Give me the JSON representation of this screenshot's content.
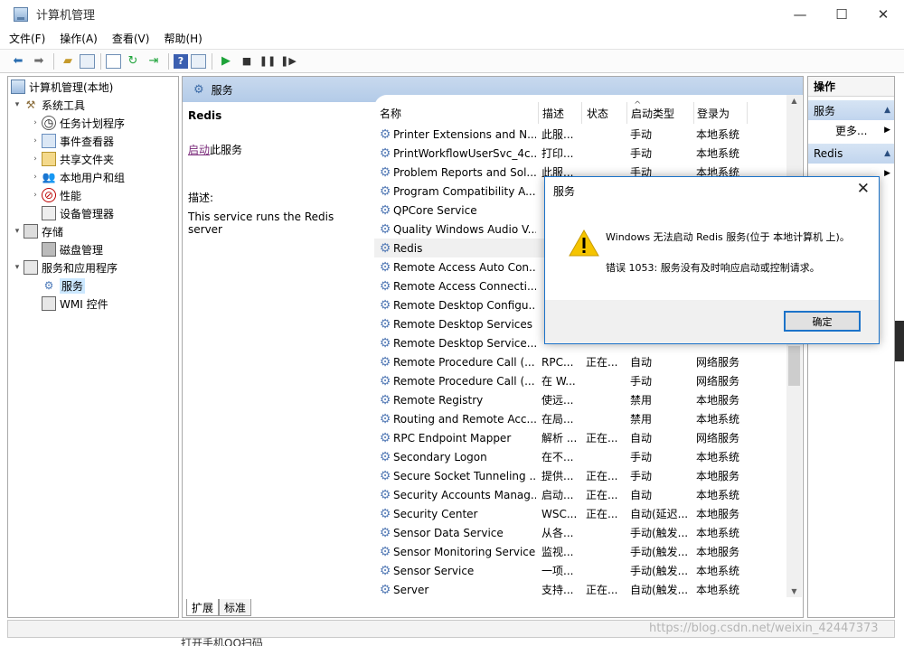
{
  "window": {
    "title": "计算机管理",
    "min": "—",
    "max": "☐",
    "close": "✕"
  },
  "menu": [
    "文件(F)",
    "操作(A)",
    "查看(V)",
    "帮助(H)"
  ],
  "tree": {
    "root": "计算机管理(本地)",
    "system_tools": "系统工具",
    "task_scheduler": "任务计划程序",
    "event_viewer": "事件查看器",
    "shared_folders": "共享文件夹",
    "local_users": "本地用户和组",
    "performance": "性能",
    "device_manager": "设备管理器",
    "storage": "存储",
    "disk_management": "磁盘管理",
    "services_apps": "服务和应用程序",
    "services": "服务",
    "wmi": "WMI 控件"
  },
  "middle": {
    "header": "服务",
    "selected_service": "Redis",
    "start_link": "启动",
    "start_suffix": "此服务",
    "desc_label": "描述:",
    "desc_text": "This service runs the Redis server"
  },
  "columns": {
    "name": "名称",
    "desc": "描述",
    "status": "状态",
    "start_type": "启动类型",
    "logon": "登录为"
  },
  "rows": [
    {
      "name": "Printer Extensions and N...",
      "desc": "此服...",
      "status": "",
      "start": "手动",
      "logon": "本地系统"
    },
    {
      "name": "PrintWorkflowUserSvc_4c...",
      "desc": "打印...",
      "status": "",
      "start": "手动",
      "logon": "本地系统"
    },
    {
      "name": "Problem Reports and Sol...",
      "desc": "此服...",
      "status": "",
      "start": "手动",
      "logon": "本地系统"
    },
    {
      "name": "Program Compatibility A...",
      "desc": "",
      "status": "",
      "start": "",
      "logon": ""
    },
    {
      "name": "QPCore Service",
      "desc": "",
      "status": "",
      "start": "",
      "logon": ""
    },
    {
      "name": "Quality Windows Audio V...",
      "desc": "",
      "status": "",
      "start": "",
      "logon": ""
    },
    {
      "name": "Redis",
      "desc": "",
      "status": "",
      "start": "",
      "logon": ""
    },
    {
      "name": "Remote Access Auto Con...",
      "desc": "",
      "status": "",
      "start": "",
      "logon": ""
    },
    {
      "name": "Remote Access Connecti...",
      "desc": "",
      "status": "",
      "start": "",
      "logon": ""
    },
    {
      "name": "Remote Desktop Configu...",
      "desc": "",
      "status": "",
      "start": "",
      "logon": ""
    },
    {
      "name": "Remote Desktop Services",
      "desc": "",
      "status": "",
      "start": "",
      "logon": ""
    },
    {
      "name": "Remote Desktop Service...",
      "desc": "",
      "status": "",
      "start": "",
      "logon": ""
    },
    {
      "name": "Remote Procedure Call (...",
      "desc": "RPC...",
      "status": "正在...",
      "start": "自动",
      "logon": "网络服务"
    },
    {
      "name": "Remote Procedure Call (...",
      "desc": "在 W...",
      "status": "",
      "start": "手动",
      "logon": "网络服务"
    },
    {
      "name": "Remote Registry",
      "desc": "使远...",
      "status": "",
      "start": "禁用",
      "logon": "本地服务"
    },
    {
      "name": "Routing and Remote Acc...",
      "desc": "在局...",
      "status": "",
      "start": "禁用",
      "logon": "本地系统"
    },
    {
      "name": "RPC Endpoint Mapper",
      "desc": "解析 ...",
      "status": "正在...",
      "start": "自动",
      "logon": "网络服务"
    },
    {
      "name": "Secondary Logon",
      "desc": "在不...",
      "status": "",
      "start": "手动",
      "logon": "本地系统"
    },
    {
      "name": "Secure Socket Tunneling ...",
      "desc": "提供...",
      "status": "正在...",
      "start": "手动",
      "logon": "本地服务"
    },
    {
      "name": "Security Accounts Manag...",
      "desc": "启动...",
      "status": "正在...",
      "start": "自动",
      "logon": "本地系统"
    },
    {
      "name": "Security Center",
      "desc": "WSC...",
      "status": "正在...",
      "start": "自动(延迟...",
      "logon": "本地服务"
    },
    {
      "name": "Sensor Data Service",
      "desc": "从各...",
      "status": "",
      "start": "手动(触发...",
      "logon": "本地系统"
    },
    {
      "name": "Sensor Monitoring Service",
      "desc": "监视...",
      "status": "",
      "start": "手动(触发...",
      "logon": "本地服务"
    },
    {
      "name": "Sensor Service",
      "desc": "一项...",
      "status": "",
      "start": "手动(触发...",
      "logon": "本地系统"
    },
    {
      "name": "Server",
      "desc": "支持...",
      "status": "正在...",
      "start": "自动(触发...",
      "logon": "本地系统"
    }
  ],
  "tabs": [
    "扩展",
    "标准"
  ],
  "actions": {
    "title": "操作",
    "group1": "服务",
    "more": "更多...",
    "group2": "Redis"
  },
  "dialog": {
    "title": "服务",
    "line1": "Windows 无法启动 Redis 服务(位于 本地计算机 上)。",
    "line2": "错误 1053: 服务没有及时响应启动或控制请求。",
    "ok": "确定"
  },
  "background_text": "打开手机QQ扫码",
  "watermark": "https://blog.csdn.net/weixin_42447373"
}
